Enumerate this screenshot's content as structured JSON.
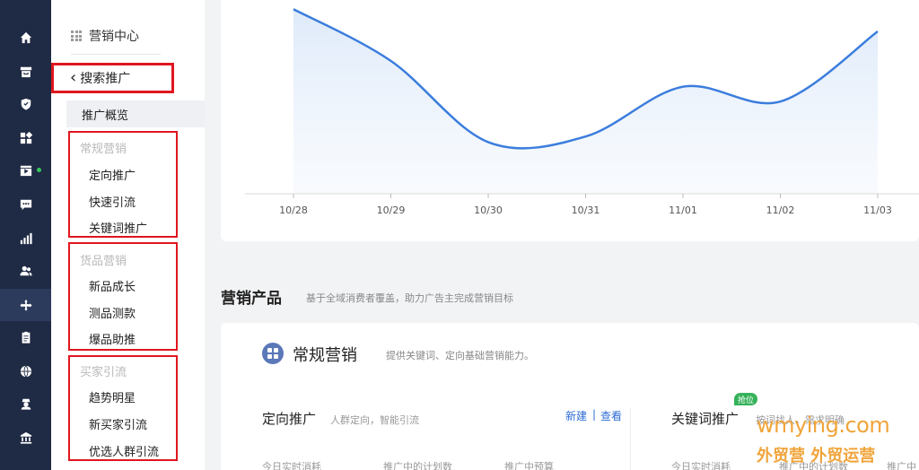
{
  "rail": {
    "items": [
      {
        "icon": "home-icon"
      },
      {
        "icon": "store-icon"
      },
      {
        "icon": "shield-icon"
      },
      {
        "icon": "apps-icon"
      },
      {
        "icon": "video-icon"
      },
      {
        "icon": "message-icon"
      },
      {
        "icon": "bar-chart-icon"
      },
      {
        "icon": "users-icon"
      },
      {
        "icon": "marketing-icon"
      },
      {
        "icon": "clipboard-icon"
      },
      {
        "icon": "globe-icon"
      },
      {
        "icon": "person-icon"
      },
      {
        "icon": "bank-icon"
      }
    ],
    "active_index": 8
  },
  "sidebar": {
    "header": "营销中心",
    "back_label": "搜索推广",
    "overview": "推广概览",
    "groups": [
      {
        "title": "常规营销",
        "items": [
          "定向推广",
          "快速引流",
          "关键词推广"
        ]
      },
      {
        "title": "货品营销",
        "items": [
          "新品成长",
          "测品测款",
          "爆品助推"
        ]
      },
      {
        "title": "买家引流",
        "items": [
          "趋势明星",
          "新买家引流",
          "优选人群引流"
        ]
      }
    ]
  },
  "chart_data": {
    "type": "line",
    "categories": [
      "10/28",
      "10/29",
      "10/30",
      "10/31",
      "11/01",
      "11/02",
      "11/03"
    ],
    "values": [
      100,
      72,
      28,
      31,
      58,
      50,
      88
    ],
    "ylim": [
      0,
      105
    ],
    "grid": false,
    "colors": {
      "line": "#3b7ddd",
      "fill": "#e3eefb"
    }
  },
  "products": {
    "title": "营销产品",
    "subtitle": "基于全域消费者覆盖，助力广告主完成营销目标",
    "category": {
      "icon": "apps-icon",
      "title": "常规营销",
      "desc": "提供关键词、定向基础营销能力。"
    },
    "targeted": {
      "title": "定向推广",
      "desc": "人群定向，智能引流",
      "new_link": "新建",
      "separator": "|",
      "view_link": "查看",
      "stats": [
        "今日实时消耗",
        "推广中的计划数",
        "推广中预算"
      ]
    },
    "keyword": {
      "title": "关键词推广",
      "badge": "抢位",
      "desc": "按词找人，需求明确",
      "stats": [
        "今日实时消耗",
        "推广中的计划数",
        "推广中"
      ]
    }
  },
  "watermark": {
    "line1": "wmying.com",
    "line2": "外贸营 外贸运营"
  }
}
